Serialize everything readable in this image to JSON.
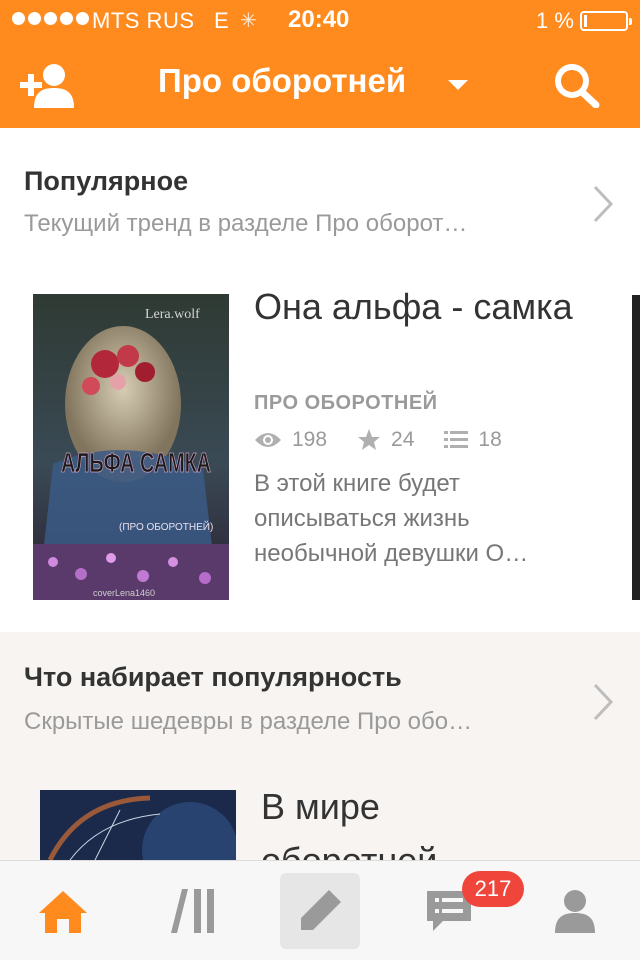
{
  "status_bar": {
    "carrier": "MTS RUS",
    "network": "E",
    "time": "20:40",
    "battery": "1 %"
  },
  "header": {
    "title": "Про оборотней",
    "icons": [
      "add-user-icon",
      "caret-down-icon",
      "search-icon"
    ]
  },
  "sections": [
    {
      "title": "Популярное",
      "subtitle": "Текущий тренд в разделе Про оборот…",
      "book": {
        "title": "Она альфа - самка",
        "category": "ПРО ОБОРОТНЕЙ",
        "views": "198",
        "votes": "24",
        "parts": "18",
        "description": "В этой книге будет описываться жизнь необычной девушки О…",
        "cover_author": "Lera.wolf",
        "cover_title": "АЛЬФА САМКА",
        "cover_subtitle": "(ПРО ОБОРОТНЕЙ)",
        "cover_credit": "coverLena1460"
      }
    },
    {
      "title": "Что набирает популярность",
      "subtitle": "Скрытые шедевры в разделе Про обо…",
      "book": {
        "title": "В мире оборотней"
      }
    }
  ],
  "tabbar": {
    "items": [
      "home-icon",
      "library-icon",
      "write-icon",
      "messages-icon",
      "profile-icon"
    ],
    "messages_badge": "217"
  },
  "colors": {
    "accent": "#ff8a1e",
    "badge": "#f0453b"
  }
}
